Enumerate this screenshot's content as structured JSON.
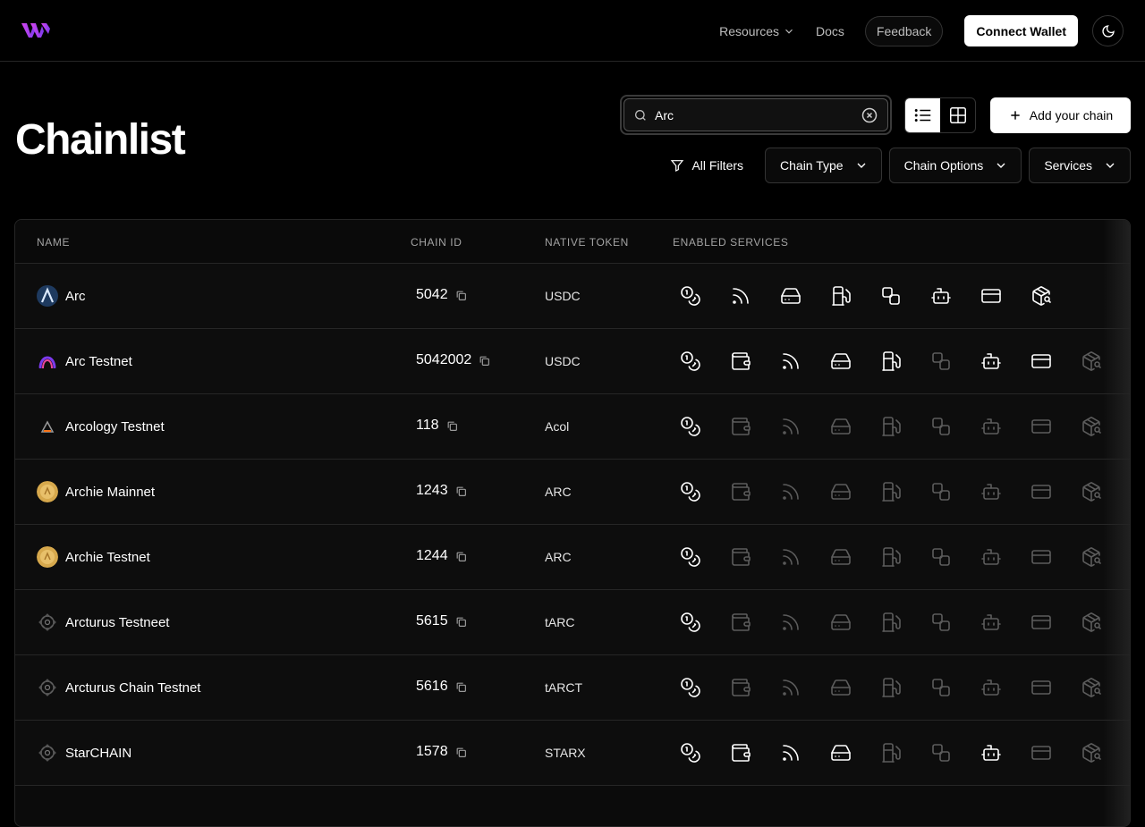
{
  "nav": {
    "resources_label": "Resources",
    "docs_label": "Docs",
    "feedback_label": "Feedback",
    "connect_label": "Connect Wallet"
  },
  "page": {
    "title": "Chainlist"
  },
  "search": {
    "value": "Arc",
    "placeholder": "Search"
  },
  "actions": {
    "add_chain_label": "Add your chain"
  },
  "filters": {
    "all_filters_label": "All Filters",
    "chain_type_label": "Chain Type",
    "chain_options_label": "Chain Options",
    "services_label": "Services"
  },
  "table": {
    "headers": {
      "name": "NAME",
      "chain_id": "CHAIN ID",
      "native_token": "NATIVE TOKEN",
      "services": "ENABLED SERVICES"
    },
    "service_icons": [
      "coins-icon",
      "wallet-icon",
      "rss-icon",
      "drive-icon",
      "fuel-icon",
      "bridge-icon",
      "bot-icon",
      "card-icon",
      "package-search-icon"
    ],
    "rows": [
      {
        "name": "Arc",
        "chain_id": "5042",
        "token": "USDC",
        "logo": "arc",
        "services": [
          1,
          null,
          1,
          1,
          1,
          1,
          1,
          1,
          1
        ]
      },
      {
        "name": "Arc Testnet",
        "chain_id": "5042002",
        "token": "USDC",
        "logo": "arc-testnet",
        "services": [
          1,
          1,
          1,
          1,
          1,
          0,
          1,
          1,
          0
        ]
      },
      {
        "name": "Arcology Testnet",
        "chain_id": "118",
        "token": "Acol",
        "logo": "arcology",
        "services": [
          1,
          0,
          0,
          0,
          0,
          0,
          0,
          0,
          0
        ]
      },
      {
        "name": "Archie Mainnet",
        "chain_id": "1243",
        "token": "ARC",
        "logo": "archie",
        "services": [
          1,
          0,
          0,
          0,
          0,
          0,
          0,
          0,
          0
        ]
      },
      {
        "name": "Archie Testnet",
        "chain_id": "1244",
        "token": "ARC",
        "logo": "archie",
        "services": [
          1,
          0,
          0,
          0,
          0,
          0,
          0,
          0,
          0
        ]
      },
      {
        "name": "Arcturus Testneet",
        "chain_id": "5615",
        "token": "tARC",
        "logo": "generic",
        "services": [
          1,
          0,
          0,
          0,
          0,
          0,
          0,
          0,
          0
        ]
      },
      {
        "name": "Arcturus Chain Testnet",
        "chain_id": "5616",
        "token": "tARCT",
        "logo": "generic",
        "services": [
          1,
          0,
          0,
          0,
          0,
          0,
          0,
          0,
          0
        ]
      },
      {
        "name": "StarCHAIN",
        "chain_id": "1578",
        "token": "STARX",
        "logo": "generic",
        "services": [
          1,
          1,
          1,
          1,
          0,
          0,
          1,
          0,
          0
        ]
      }
    ]
  }
}
